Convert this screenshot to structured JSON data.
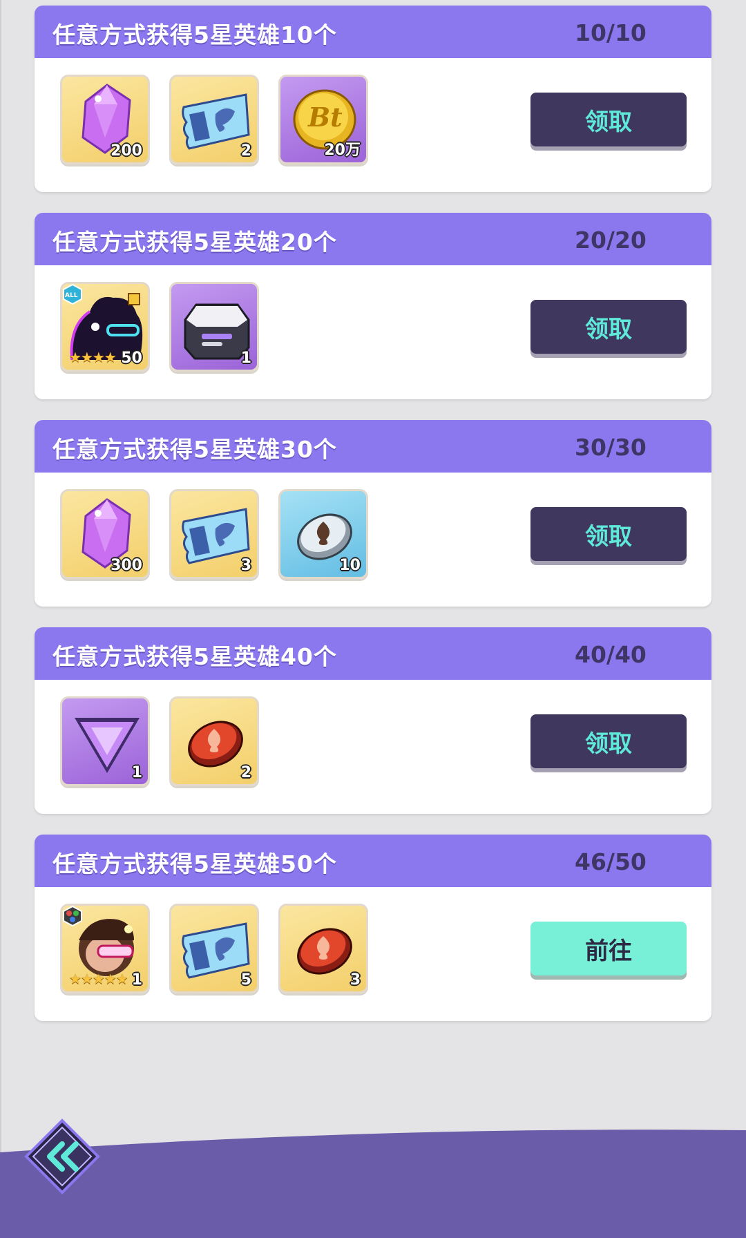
{
  "tasks": [
    {
      "title": "任意方式获得5星英雄10个",
      "progress": "10/10",
      "button": "领取",
      "button_state": "claim",
      "rewards": [
        {
          "icon": "purple-gem-icon",
          "bg": "gold",
          "qty": "200"
        },
        {
          "icon": "blue-ticket-icon",
          "bg": "gold",
          "qty": "2"
        },
        {
          "icon": "bt-gold-coin-icon",
          "bg": "purple",
          "qty": "20万"
        }
      ]
    },
    {
      "title": "任意方式获得5星英雄20个",
      "progress": "20/20",
      "button": "领取",
      "button_state": "claim",
      "rewards": [
        {
          "icon": "hero-shard-silhouette-icon",
          "bg": "gold",
          "qty": "50",
          "badge": "ALL",
          "stars": "★★★★"
        },
        {
          "icon": "silver-chest-icon",
          "bg": "purple",
          "qty": "1"
        }
      ]
    },
    {
      "title": "任意方式获得5星英雄30个",
      "progress": "30/30",
      "button": "领取",
      "button_state": "claim",
      "rewards": [
        {
          "icon": "purple-gem-icon",
          "bg": "gold",
          "qty": "300"
        },
        {
          "icon": "blue-ticket-icon",
          "bg": "gold",
          "qty": "3"
        },
        {
          "icon": "silver-spade-token-icon",
          "bg": "blue",
          "qty": "10"
        }
      ]
    },
    {
      "title": "任意方式获得5星英雄40个",
      "progress": "40/40",
      "button": "领取",
      "button_state": "claim",
      "rewards": [
        {
          "icon": "purple-triangle-crystal-icon",
          "bg": "purple",
          "qty": "1"
        },
        {
          "icon": "red-spade-token-icon",
          "bg": "gold",
          "qty": "2"
        }
      ]
    },
    {
      "title": "任意方式获得5星英雄50个",
      "progress": "46/50",
      "button": "前往",
      "button_state": "go",
      "rewards": [
        {
          "icon": "hero-portrait-goggles-icon",
          "bg": "gold",
          "qty": "1",
          "badge": "multi-element",
          "stars": "★★★★★"
        },
        {
          "icon": "blue-ticket-icon",
          "bg": "gold",
          "qty": "5"
        },
        {
          "icon": "red-spade-token-icon",
          "bg": "gold",
          "qty": "3"
        }
      ]
    }
  ],
  "colors": {
    "header": "#8b78ee",
    "claim_button": "#40375e",
    "claim_text": "#5fe9d9",
    "go_button": "#78f0d8",
    "bottom_band": "#6a5ca8"
  },
  "back_button_icon": "double-chevron-left-icon"
}
